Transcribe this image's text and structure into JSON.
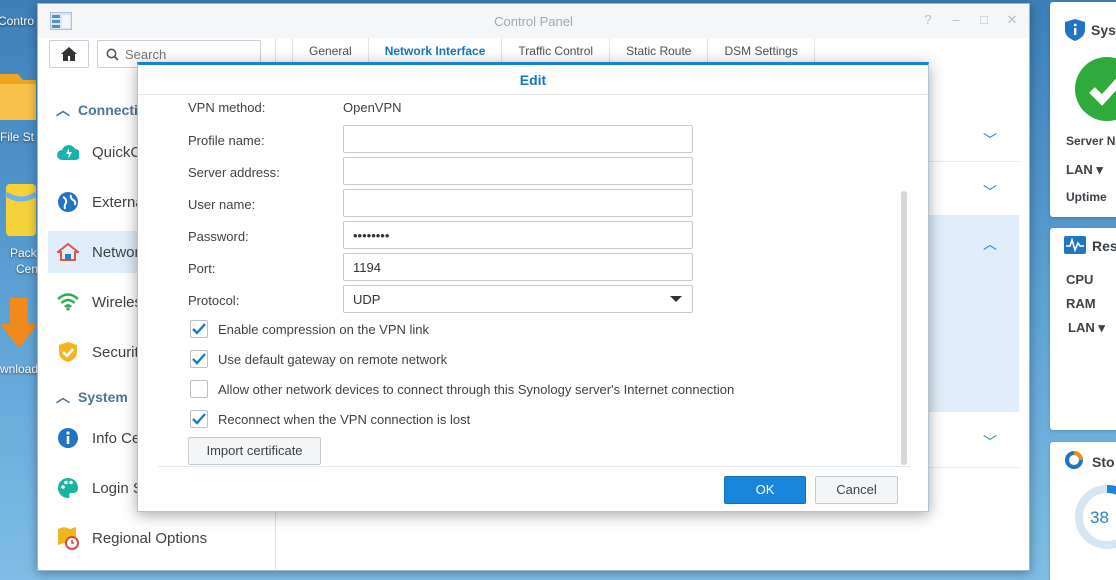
{
  "desktop": {
    "icons": [
      {
        "label": "Contro"
      },
      {
        "label": "File St"
      },
      {
        "label": "Pack"
      },
      {
        "label": "Cen"
      },
      {
        "label": "wnload"
      }
    ]
  },
  "window": {
    "title": "Control Panel",
    "controls": [
      "?",
      "–",
      "□",
      "✕"
    ]
  },
  "sidebar": {
    "search_placeholder": "Search",
    "section_connectivity": "Connecti",
    "section_system": "System",
    "items": [
      {
        "label": "QuickCo",
        "icon": "quickconnect-icon"
      },
      {
        "label": "Externa",
        "icon": "globe-icon"
      },
      {
        "label": "Network",
        "icon": "home-network-icon"
      },
      {
        "label": "Wireles",
        "icon": "wifi-icon"
      },
      {
        "label": "Security",
        "icon": "shield-icon"
      },
      {
        "label": "Info Ce",
        "icon": "info-icon"
      },
      {
        "label": "Login S",
        "icon": "palette-icon"
      },
      {
        "label": "Regional Options",
        "icon": "regional-icon"
      }
    ]
  },
  "tabs": [
    "General",
    "Network Interface",
    "Traffic Control",
    "Static Route",
    "DSM Settings"
  ],
  "active_tab": "Network Interface",
  "widgets": {
    "system": {
      "title": "Sys",
      "server": "Server N",
      "lan": "LAN ▾",
      "uptime": "Uptime"
    },
    "resource": {
      "title": "Res",
      "cpu": "CPU",
      "ram": "RAM",
      "lan": "LAN ▾"
    },
    "storage": {
      "title": "Sto",
      "value": "38"
    }
  },
  "dialog": {
    "title": "Edit",
    "vpn_method_label": "VPN method:",
    "vpn_method_value": "OpenVPN",
    "profile_label": "Profile name:",
    "profile_value": "",
    "server_label": "Server address:",
    "server_value": "",
    "user_label": "User name:",
    "user_value": "",
    "password_label": "Password:",
    "password_value": "••••••••",
    "port_label": "Port:",
    "port_value": "1194",
    "protocol_label": "Protocol:",
    "protocol_value": "UDP",
    "checkboxes": [
      {
        "label": "Enable compression on the VPN link",
        "checked": true
      },
      {
        "label": "Use default gateway on remote network",
        "checked": true
      },
      {
        "label": "Allow other network devices to connect through this Synology server's Internet connection",
        "checked": false
      },
      {
        "label": "Reconnect when the VPN connection is lost",
        "checked": true
      }
    ],
    "import_label": "Import certificate",
    "ok_label": "OK",
    "cancel_label": "Cancel"
  },
  "colors": {
    "accent": "#1a86db",
    "title_blue": "#0f77c6",
    "selected_bg": "#dfeefa"
  }
}
